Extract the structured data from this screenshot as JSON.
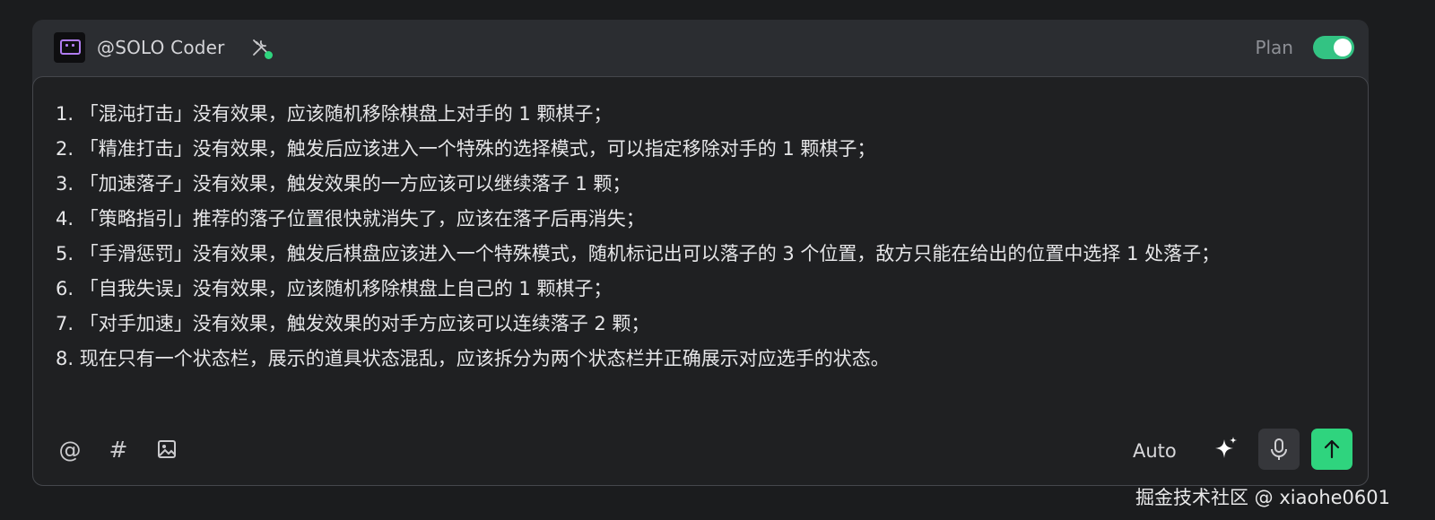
{
  "header": {
    "agent_name": "@SOLO Coder",
    "mode_label": "Plan",
    "mode_enabled": true
  },
  "message": {
    "lines": [
      "1. 「混沌打击」没有效果，应该随机移除棋盘上对手的 1 颗棋子；",
      "2. 「精准打击」没有效果，触发后应该进入一个特殊的选择模式，可以指定移除对手的 1 颗棋子；",
      "3. 「加速落子」没有效果，触发效果的一方应该可以继续落子 1 颗；",
      "4. 「策略指引」推荐的落子位置很快就消失了，应该在落子后再消失；",
      "5. 「手滑惩罚」没有效果，触发后棋盘应该进入一个特殊模式，随机标记出可以落子的 3 个位置，敌方只能在给出的位置中选择 1 处落子；",
      "6. 「自我失误」没有效果，应该随机移除棋盘上自己的 1 颗棋子；",
      "7. 「对手加速」没有效果，触发效果的对手方应该可以连续落子 2 颗；",
      "8. 现在只有一个状态栏，展示的道具状态混乱，应该拆分为两个状态栏并正确展示对应选手的状态。"
    ]
  },
  "toolbar": {
    "mention_icon": "@",
    "hash_icon": "#",
    "image_icon": "image-icon",
    "model_label": "Auto",
    "sparkle_icon": "sparkle-icon",
    "mic_icon": "microphone-icon",
    "send_icon": "arrow-up-icon"
  },
  "watermark": "掘金技术社区 @ xiaohe0601",
  "colors": {
    "accent": "#2fd47e",
    "toggle": "#33c383",
    "avatar_purple": "#b07cf0"
  }
}
